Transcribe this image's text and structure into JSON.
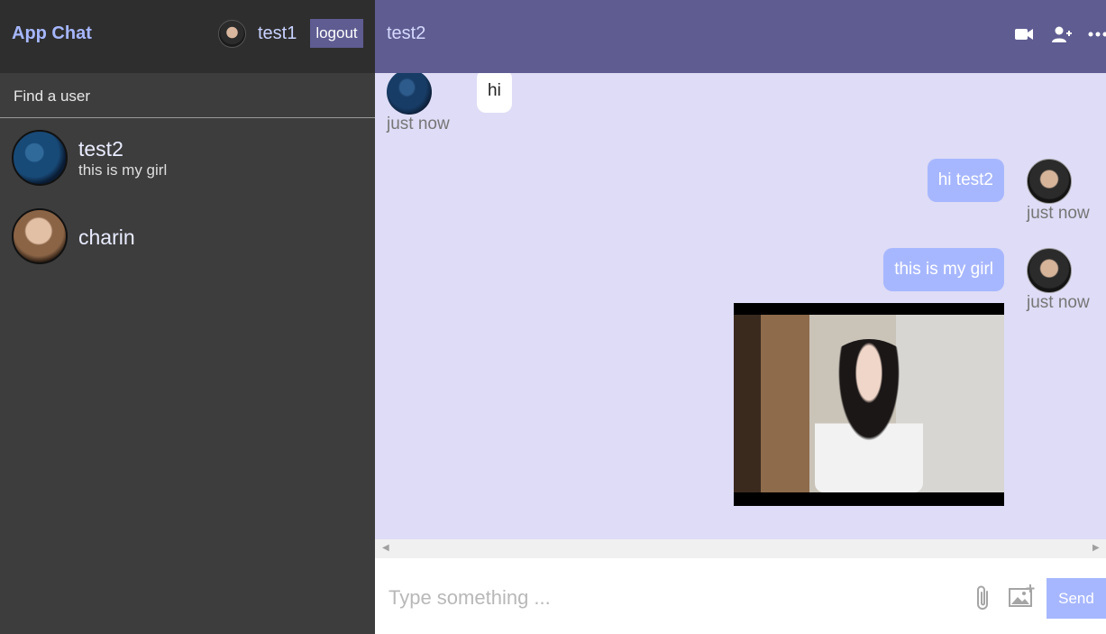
{
  "sidebar": {
    "brand": "App Chat",
    "current_user": "test1",
    "logout_label": "logout",
    "search_placeholder": "Find a user",
    "users": [
      {
        "name": "test2",
        "last_message": "this is my girl"
      },
      {
        "name": "charin",
        "last_message": ""
      }
    ]
  },
  "chat": {
    "title": "test2",
    "header_icons": [
      "video-camera-icon",
      "add-user-icon",
      "more-options-icon"
    ],
    "messages": [
      {
        "direction": "incoming",
        "text": "hi",
        "time": "just now"
      },
      {
        "direction": "outgoing",
        "text": "hi test2",
        "time": "just now"
      },
      {
        "direction": "outgoing",
        "text": "this is my girl",
        "time": "just now",
        "has_image": true
      }
    ],
    "composer": {
      "placeholder": "Type something ...",
      "icons": [
        "attach-icon",
        "add-image-icon"
      ],
      "send_label": "Send"
    }
  },
  "colors": {
    "sidebar_bg": "#3d3d3d",
    "sidebar_top_bg": "#2e2e2e",
    "header_bg": "#5e5c91",
    "chat_bg": "#dedcf6",
    "accent": "#a7b7ff"
  }
}
